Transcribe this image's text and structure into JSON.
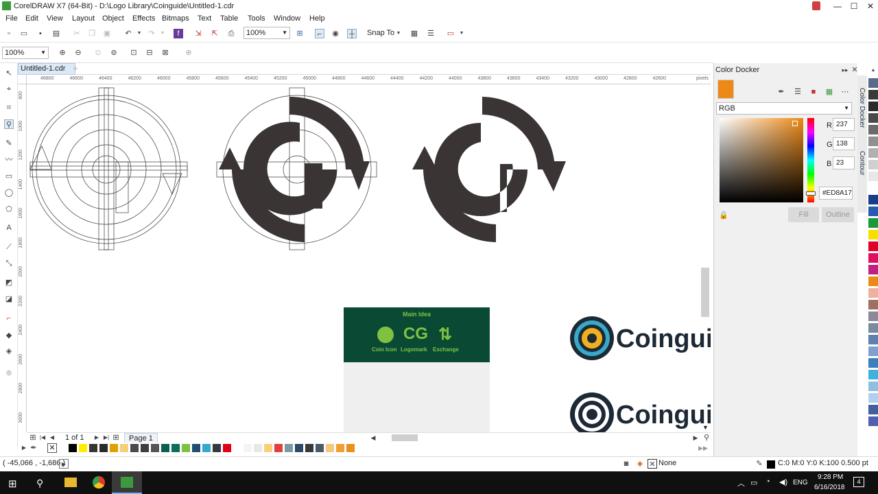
{
  "window": {
    "title": "CorelDRAW X7 (64-Bit) - D:\\Logo Library\\Coinguide\\Untitled-1.cdr",
    "minimize": "—",
    "maximize": "☐",
    "close": "✕"
  },
  "menu": [
    "File",
    "Edit",
    "View",
    "Layout",
    "Object",
    "Effects",
    "Bitmaps",
    "Text",
    "Table",
    "Tools",
    "Window",
    "Help"
  ],
  "toolbar": {
    "zoom_value": "100%",
    "snap_to": "Snap To"
  },
  "property_bar": {
    "zoom_value": "100%"
  },
  "document": {
    "tab_label": "Untitled-1.cdr",
    "add_tab": "+",
    "ruler_units": "pixels"
  },
  "hruler_labels": [
    "46800",
    "46600",
    "46400",
    "46200",
    "46000",
    "45800",
    "45600",
    "45400",
    "45200",
    "45000",
    "44800",
    "44600",
    "44400",
    "44200",
    "44000",
    "43800",
    "43600",
    "43400",
    "43200",
    "43000",
    "42800",
    "42600"
  ],
  "vruler_labels": [
    "800",
    "1000",
    "1200",
    "1400",
    "1600",
    "1800",
    "2000",
    "2200",
    "2400",
    "2600",
    "2800",
    "3000"
  ],
  "canvas": {
    "dark_color": "#3a3534",
    "info_panel": {
      "title": "Main Idea",
      "icons": [
        {
          "symbol": "CG",
          "label": "Logomark"
        },
        {
          "symbol": "⇅",
          "label": "Exchange"
        }
      ],
      "circle_label": "Coin Icon",
      "bg": "#0a4a35",
      "fg": "#7fc242"
    },
    "wordmark": "Coingui"
  },
  "page_nav": {
    "page_count": "1 of 1",
    "page_tab": "Page 1"
  },
  "status": {
    "coords": "( -45,066 , -1,686 )",
    "fill_label": "None",
    "outline_info": "C:0 M:0 Y:0 K:100  0.500 pt"
  },
  "color_docker": {
    "title": "Color Docker",
    "model": "RGB",
    "r_label": "R",
    "g_label": "G",
    "b_label": "B",
    "r": "237",
    "g": "138",
    "b": "23",
    "hex": "#ED8A17",
    "fill_btn": "Fill",
    "outline_btn": "Outline",
    "current_color": "#ED8A17",
    "tabs": [
      "Color Docker",
      "Contour"
    ]
  },
  "palette": [
    "#ffffff",
    "#000000",
    "#ffed00",
    "#3a3534",
    "#2b2b2b",
    "#e0a000",
    "#f5cf7a",
    "#4a4a4a",
    "#3e3e3e",
    "#555555",
    "#0b5e50",
    "#0f6e5a",
    "#7fc242",
    "#1c4f74",
    "#38a9c8",
    "#38383f",
    "#e2001a",
    "#ffffff",
    "#f5f5f5",
    "#e8e8e8",
    "#f5d27a",
    "#e04040",
    "#7a9aaa",
    "#2a4a6a",
    "#3a3a3a",
    "#4a5a6a",
    "#f5c880",
    "#f0a030",
    "#e89020"
  ],
  "right_palette": [
    "#5a6a8a",
    "#3a3a3a",
    "#2b2b2b",
    "#4a4a4a",
    "#6a6a6a",
    "#909090",
    "#b0b0b0",
    "#d0d0d0",
    "#e8e8e8",
    "#ffffff",
    "#1a3a8a",
    "#2a5ab0",
    "#1a9a3a",
    "#f5e000",
    "#e0002a",
    "#e01060",
    "#c02080",
    "#ed8a17",
    "#f0b0a0",
    "#a07060",
    "#8a8a9a",
    "#7a8aa0",
    "#6080b0",
    "#80a0d0",
    "#3a80c0",
    "#40b0e0",
    "#90c0e0",
    "#b0d0f0",
    "#4060a0",
    "#5060b0"
  ],
  "taskbar": {
    "lang": "ENG",
    "time": "9:28 PM",
    "date": "6/16/2018",
    "notif_count": "4"
  }
}
